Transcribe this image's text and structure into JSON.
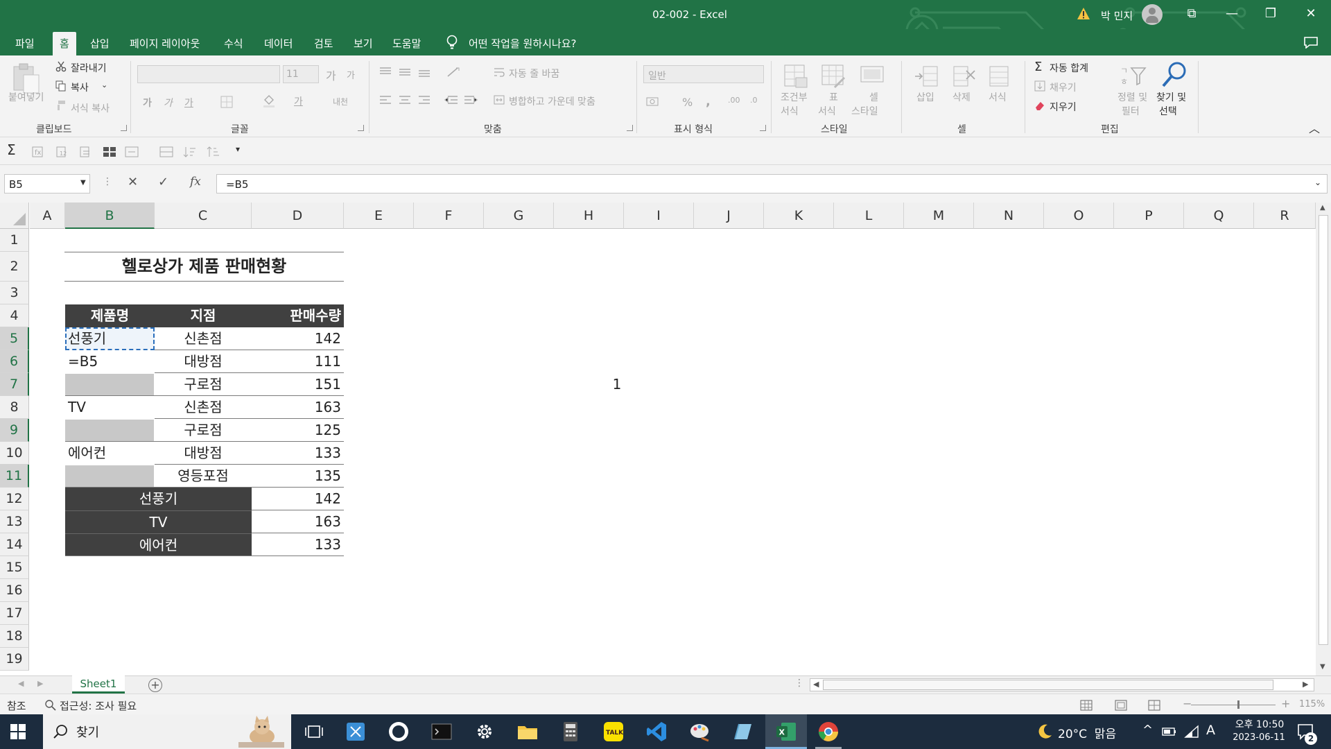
{
  "window": {
    "title": "02-002  -  Excel",
    "user": "박 민지",
    "restore_glyph": "⧉",
    "minimize_glyph": "—",
    "maximize_glyph": "❐",
    "close_glyph": "✕"
  },
  "menu": {
    "tabs": [
      "파일",
      "홈",
      "삽입",
      "페이지 레이아웃",
      "수식",
      "데이터",
      "검토",
      "보기",
      "도움말"
    ],
    "active_tab": "홈",
    "tell_me": "어떤 작업을 원하시나요?"
  },
  "ribbon": {
    "clipboard": {
      "paste": "붙여넣기",
      "cut": "잘라내기",
      "copy": "복사",
      "format_painter": "서식 복사",
      "label": "클립보드"
    },
    "font": {
      "label": "글꼴",
      "size": "11",
      "grow": "가",
      "shrink": "가",
      "bold": "가",
      "italic": "가",
      "underline": "가",
      "phonetic": "내천"
    },
    "alignment": {
      "label": "맞춤",
      "wrap_text": "자동 줄 바꿈",
      "merge_center": "병합하고 가운데 맞춤"
    },
    "number": {
      "label": "표시 형식",
      "format": "일반",
      "percent": "%",
      "comma": ","
    },
    "styles": {
      "label": "스타일",
      "conditional": [
        "조건부",
        "서식"
      ],
      "table": [
        "표",
        "서식"
      ],
      "cell": [
        "셀",
        "스타일"
      ]
    },
    "cells": {
      "label": "셀",
      "insert": "삽입",
      "delete": "삭제",
      "format": "서식"
    },
    "editing": {
      "label": "편집",
      "autosum": "자동 합계",
      "fill": "채우기",
      "clear": "지우기",
      "sort_filter": [
        "정렬 및",
        "필터"
      ],
      "find_select": [
        "찾기 및",
        "선택"
      ]
    }
  },
  "formula_bar": {
    "name_box": "B5",
    "cancel": "✕",
    "enter": "✓",
    "fx": "fx",
    "formula": "=B5"
  },
  "grid": {
    "columns": [
      "A",
      "B",
      "C",
      "D",
      "E",
      "F",
      "G",
      "H",
      "I",
      "J",
      "K",
      "L",
      "M",
      "N",
      "O",
      "P",
      "Q",
      "R"
    ],
    "rows": [
      "1",
      "2",
      "3",
      "4",
      "5",
      "6",
      "7",
      "8",
      "9",
      "10",
      "11",
      "12",
      "13",
      "14",
      "15",
      "16",
      "17",
      "18",
      "19"
    ],
    "selected_column": "B",
    "selected_rows": [
      "5",
      "6",
      "7",
      "9",
      "11"
    ]
  },
  "sheet": {
    "title": "헬로상가 제품 판매현황",
    "headers": [
      "제품명",
      "지점",
      "판매수량"
    ],
    "rows": [
      {
        "product": "선풍기",
        "branch": "신촌점",
        "qty": "142"
      },
      {
        "product": "=B5",
        "branch": "대방점",
        "qty": "111"
      },
      {
        "product": "",
        "branch": "구로점",
        "qty": "151"
      },
      {
        "product": "TV",
        "branch": "신촌점",
        "qty": "163"
      },
      {
        "product": "",
        "branch": "구로점",
        "qty": "125"
      },
      {
        "product": "에어컨",
        "branch": "대방점",
        "qty": "133"
      },
      {
        "product": "",
        "branch": "영등포점",
        "qty": "135"
      }
    ],
    "summary": [
      {
        "product": "선풍기",
        "qty": "142"
      },
      {
        "product": "TV",
        "qty": "163"
      },
      {
        "product": "에어컨",
        "qty": "133"
      }
    ],
    "h7_value": "1"
  },
  "tabs_bar": {
    "sheet_name": "Sheet1",
    "add": "+"
  },
  "status": {
    "mode": "참조",
    "accessibility": "접근성: 조사 필요",
    "zoom": "115%",
    "zoom_level": 0.56
  },
  "taskbar": {
    "search": "찾기",
    "weather": "20°C  맑음",
    "ime": "A",
    "time": "오후 10:50",
    "date": "2023-06-11",
    "notifications": "2"
  },
  "colors": {
    "excel_green": "#217346",
    "table_dark": "#404040",
    "table_grey": "#c8c8c8"
  }
}
